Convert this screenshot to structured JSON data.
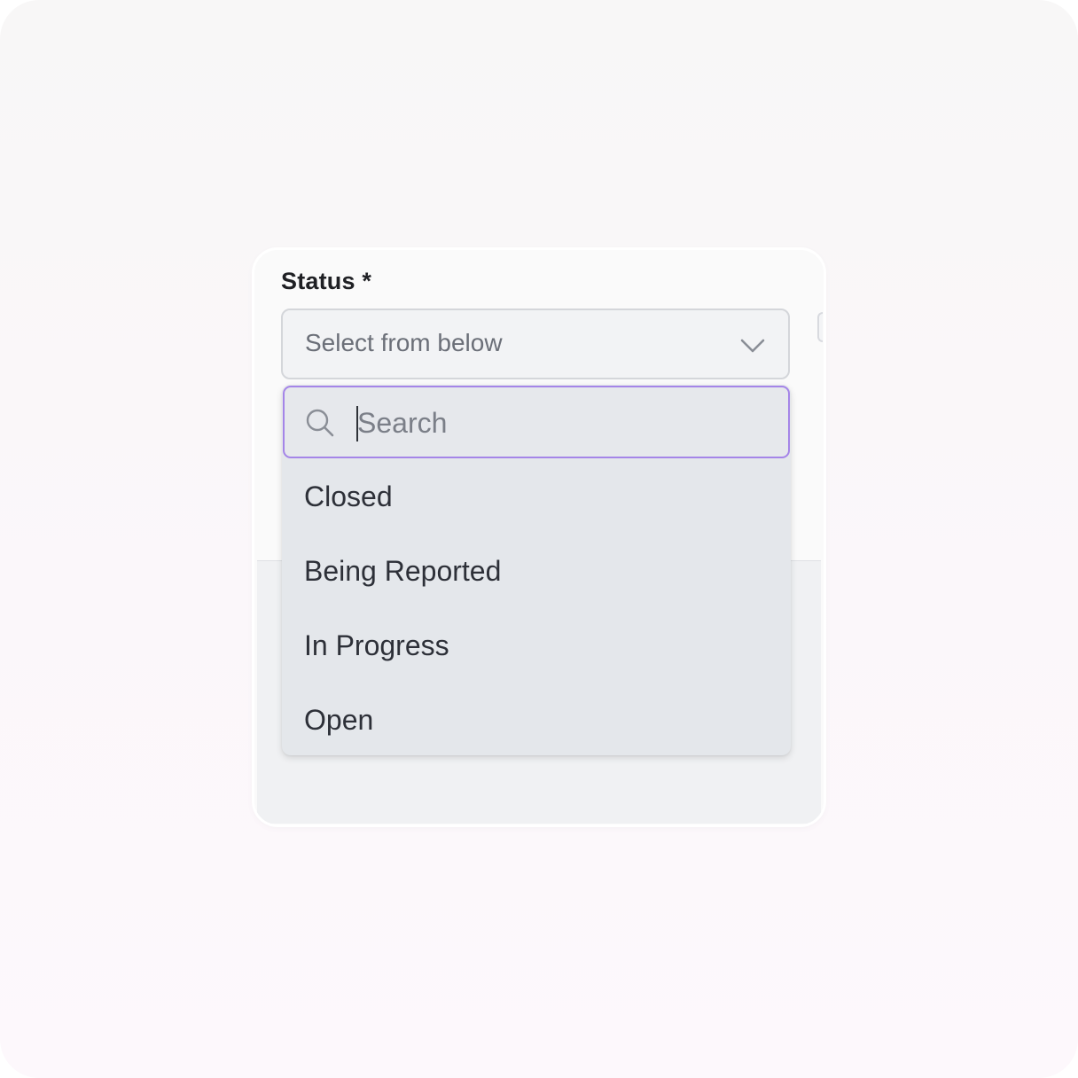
{
  "field": {
    "label": "Status *",
    "select_placeholder": "Select from below"
  },
  "dropdown": {
    "search_placeholder": "Search",
    "options": [
      {
        "label": "Closed"
      },
      {
        "label": "Being Reported"
      },
      {
        "label": "In Progress"
      },
      {
        "label": "Open"
      }
    ]
  },
  "icons": {
    "search": "search-icon",
    "chevron": "chevron-down-icon"
  },
  "colors": {
    "focus_border": "#a585e8",
    "dropdown_bg": "#e4e7eb",
    "text": "#2d3038",
    "placeholder": "#6b6f78"
  }
}
